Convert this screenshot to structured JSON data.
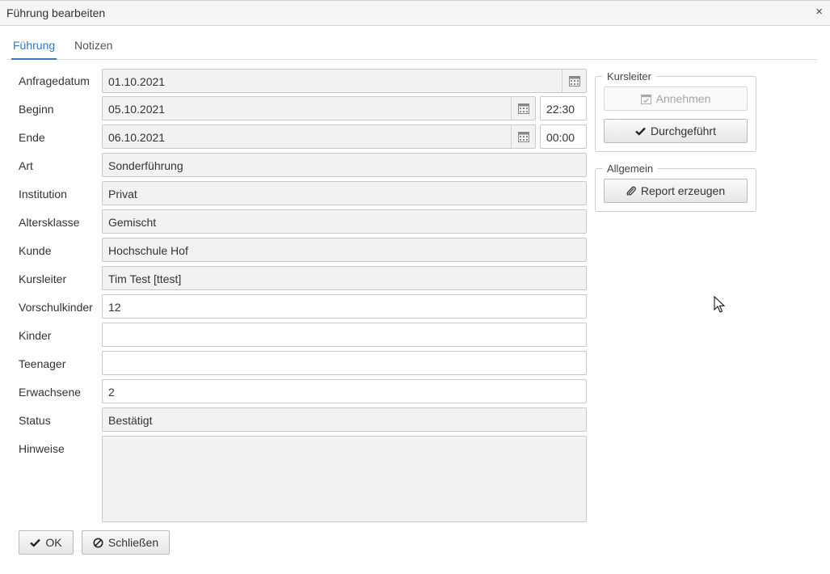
{
  "window": {
    "title": "Führung bearbeiten",
    "close_glyph": "×"
  },
  "tabs": [
    {
      "label": "Führung",
      "active": true
    },
    {
      "label": "Notizen",
      "active": false
    }
  ],
  "form": {
    "anfragedatum": {
      "label": "Anfragedatum",
      "value": "01.10.2021"
    },
    "beginn": {
      "label": "Beginn",
      "date": "05.10.2021",
      "time": "22:30"
    },
    "ende": {
      "label": "Ende",
      "date": "06.10.2021",
      "time": "00:00"
    },
    "art": {
      "label": "Art",
      "value": "Sonderführung"
    },
    "institution": {
      "label": "Institution",
      "value": "Privat"
    },
    "altersklasse": {
      "label": "Altersklasse",
      "value": "Gemischt"
    },
    "kunde": {
      "label": "Kunde",
      "value": "Hochschule Hof"
    },
    "kursleiter": {
      "label": "Kursleiter",
      "value": "Tim Test [ttest]"
    },
    "vorschulkinder": {
      "label": "Vorschulkinder",
      "value": "12"
    },
    "kinder": {
      "label": "Kinder",
      "value": ""
    },
    "teenager": {
      "label": "Teenager",
      "value": ""
    },
    "erwachsene": {
      "label": "Erwachsene",
      "value": "2"
    },
    "status": {
      "label": "Status",
      "value": "Bestätigt"
    },
    "hinweise": {
      "label": "Hinweise",
      "value": ""
    }
  },
  "side": {
    "kursleiter_group": {
      "legend": "Kursleiter",
      "annehmen_label": "Annehmen",
      "durchgefuehrt_label": "Durchgeführt"
    },
    "allgemein_group": {
      "legend": "Allgemein",
      "report_label": "Report erzeugen"
    }
  },
  "footer": {
    "ok_label": "OK",
    "close_label": "Schließen"
  },
  "icons": {
    "calendar": "calendar-icon",
    "calendar_check": "calendar-check-icon",
    "check": "check-icon",
    "paperclip": "paperclip-icon",
    "ban": "ban-icon",
    "close": "close-icon",
    "cursor": "mouse-cursor"
  },
  "colors": {
    "accent": "#2f7bbf",
    "readonly_bg": "#f2f2f2",
    "border": "#c8c8c8"
  }
}
